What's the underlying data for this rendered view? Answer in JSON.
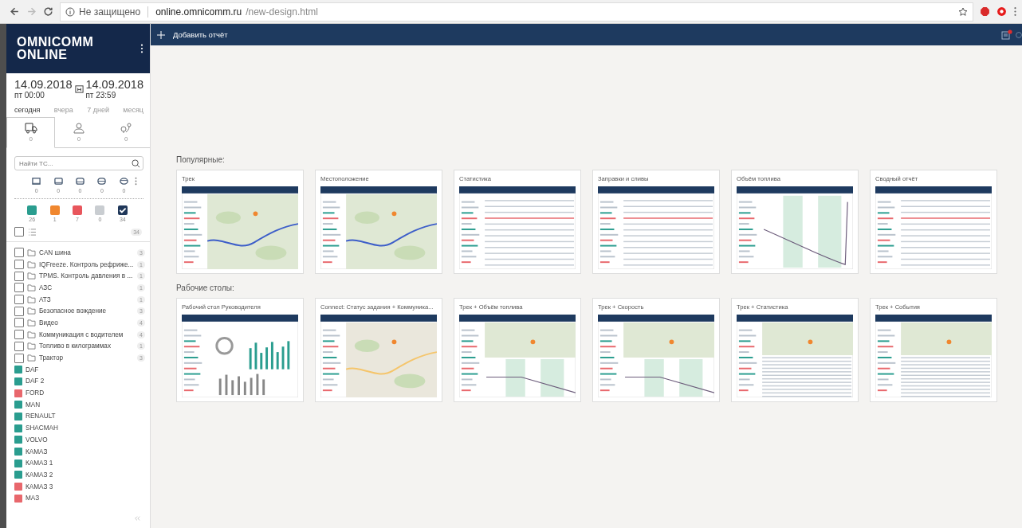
{
  "browser": {
    "security": "Не защищено",
    "url_host": "online.omnicomm.ru",
    "url_path": "/new-design.html"
  },
  "sidebar": {
    "logo": [
      "OMNICOMM",
      "ONLINE"
    ],
    "date_from": {
      "date": "14.09.2018",
      "time": "пт 00:00"
    },
    "date_to": {
      "date": "14.09.2018",
      "time": "пт 23:59"
    },
    "ranges": [
      {
        "label": "сегодня",
        "selected": true
      },
      {
        "label": "вчера",
        "selected": false
      },
      {
        "label": "7 дней",
        "selected": false
      },
      {
        "label": "месяц",
        "selected": false
      }
    ],
    "tabs": [
      {
        "count": "0",
        "selected": true
      },
      {
        "count": "0",
        "selected": false
      },
      {
        "count": "0",
        "selected": false
      }
    ],
    "search": {
      "placeholder": "Найти ТС..."
    },
    "filters": [
      {
        "count": "0"
      },
      {
        "count": "0"
      },
      {
        "count": "0"
      },
      {
        "count": "0"
      },
      {
        "count": "0"
      }
    ],
    "statuses": [
      {
        "color": "#2a9d8f",
        "count": "26",
        "checked": false
      },
      {
        "color": "#f0872f",
        "count": "1",
        "checked": false
      },
      {
        "color": "#e8565c",
        "count": "7",
        "checked": false
      },
      {
        "color": "#c9cdd1",
        "count": "0",
        "checked": false
      },
      {
        "color": "#1f3759",
        "count": "34",
        "checked": true
      }
    ],
    "select_all": {
      "checked": false,
      "count": "34"
    },
    "groups": [
      {
        "name": "CAN шина",
        "count": "3",
        "checked": false
      },
      {
        "name": "IQFreeze. Контроль рефриже...",
        "count": "1",
        "checked": false
      },
      {
        "name": "TPMS. Контроль давления в ...",
        "count": "1",
        "checked": false
      },
      {
        "name": "АЗС",
        "count": "1",
        "checked": false
      },
      {
        "name": "АТЗ",
        "count": "1",
        "checked": false
      },
      {
        "name": "Безопасное вождение",
        "count": "3",
        "checked": false
      },
      {
        "name": "Видео",
        "count": "4",
        "checked": false
      },
      {
        "name": "Коммуникация с водителем",
        "count": "4",
        "checked": false
      },
      {
        "name": "Топливо в килограммах",
        "count": "1",
        "checked": false
      },
      {
        "name": "Трактор",
        "count": "3",
        "checked": false
      }
    ],
    "vehicles": [
      {
        "name": "DAF",
        "color": "#2a9d8f"
      },
      {
        "name": "DAF 2",
        "color": "#2a9d8f"
      },
      {
        "name": "FORD",
        "color": "#e8676c"
      },
      {
        "name": "MAN",
        "color": "#2a9d8f"
      },
      {
        "name": "RENAULT",
        "color": "#2a9d8f"
      },
      {
        "name": "SHACMAH",
        "color": "#2a9d8f"
      },
      {
        "name": "VOLVO",
        "color": "#2a9d8f"
      },
      {
        "name": "КАМАЗ",
        "color": "#2a9d8f"
      },
      {
        "name": "КАМАЗ 1",
        "color": "#2a9d8f"
      },
      {
        "name": "КАМАЗ 2",
        "color": "#2a9d8f"
      },
      {
        "name": "КАМАЗ 3",
        "color": "#e8676c"
      },
      {
        "name": "МАЗ",
        "color": "#e8676c"
      }
    ]
  },
  "topbar": {
    "add_report": "Добавить отчёт",
    "notifications": true
  },
  "sections": [
    {
      "title": "Популярные:",
      "cards": [
        {
          "title": "Трек",
          "kind": "map"
        },
        {
          "title": "Местоположение",
          "kind": "map"
        },
        {
          "title": "Статистика",
          "kind": "table"
        },
        {
          "title": "Заправки и сливы",
          "kind": "table"
        },
        {
          "title": "Объём топлива",
          "kind": "chart"
        },
        {
          "title": "Сводный отчёт",
          "kind": "table"
        }
      ]
    },
    {
      "title": "Рабочие столы:",
      "cards": [
        {
          "title": "Рабочий стол Руководителя",
          "kind": "dashboard"
        },
        {
          "title": "Connect: Статус задания + Коммуника...",
          "kind": "city"
        },
        {
          "title": "Трек + Объём топлива",
          "kind": "map_chart"
        },
        {
          "title": "Трек + Скорость",
          "kind": "map_chart"
        },
        {
          "title": "Трек + Статистика",
          "kind": "map_table"
        },
        {
          "title": "Трек + События",
          "kind": "map_table"
        }
      ]
    }
  ]
}
